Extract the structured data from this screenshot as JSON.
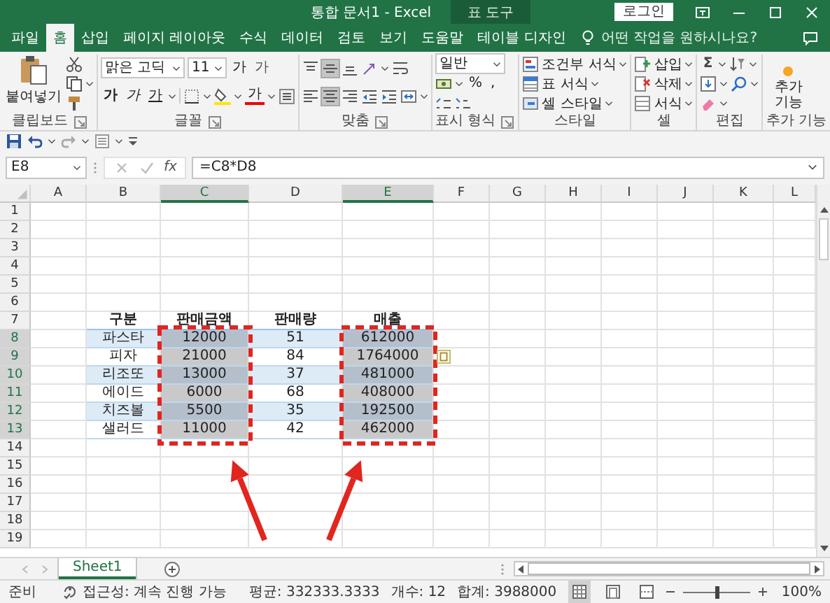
{
  "window": {
    "title": "통합 문서1 - Excel",
    "context_tab": "표 도구",
    "login": "로그인"
  },
  "tabs": [
    {
      "label": "파일",
      "selected": false
    },
    {
      "label": "홈",
      "selected": true
    },
    {
      "label": "삽입",
      "selected": false
    },
    {
      "label": "페이지 레이아웃",
      "selected": false
    },
    {
      "label": "수식",
      "selected": false
    },
    {
      "label": "데이터",
      "selected": false
    },
    {
      "label": "검토",
      "selected": false
    },
    {
      "label": "보기",
      "selected": false
    },
    {
      "label": "도움말",
      "selected": false
    },
    {
      "label": "테이블 디자인",
      "selected": false
    }
  ],
  "tell_me": {
    "placeholder": "어떤 작업을 원하시나요?"
  },
  "ribbon": [
    {
      "kind": "clipboard",
      "label": "클립보드",
      "launcher": true,
      "paste": "붙여넣기"
    },
    {
      "kind": "font",
      "label": "글꼴",
      "launcher": true,
      "font": "맑은 고딕",
      "size": "11",
      "grow": "가",
      "shrink": "가",
      "bold": "가",
      "italic": "가",
      "underline": "가",
      "color_button": "가"
    },
    {
      "kind": "alignment",
      "label": "맞춤",
      "launcher": true,
      "vertical_align": [
        {
          "kind": "top",
          "selected": false
        },
        {
          "kind": "middle",
          "selected": true
        },
        {
          "kind": "bottom",
          "selected": false
        }
      ],
      "horizontal_align": [
        {
          "kind": "left",
          "selected": false
        },
        {
          "kind": "center",
          "selected": true
        },
        {
          "kind": "right",
          "selected": false
        }
      ]
    },
    {
      "kind": "number",
      "label": "표시 형식",
      "launcher": true,
      "format": "일반",
      "percent": "%",
      "comma": ","
    },
    {
      "kind": "list",
      "label": "스타일",
      "launcher": false,
      "items": [
        "조건부 서식",
        "표 서식",
        "셀 스타일"
      ]
    },
    {
      "kind": "list",
      "label": "셀",
      "launcher": false,
      "items": [
        "삽입",
        "삭제",
        "서식"
      ]
    },
    {
      "kind": "editing",
      "label": "편집",
      "launcher": false,
      "sum": "Σ"
    },
    {
      "kind": "addin",
      "label": "추가 기능",
      "launcher": false,
      "button": "추가 기능"
    }
  ],
  "formula_bar": {
    "name_box": "E8",
    "fx": "fx",
    "formula": "=C8*D8"
  },
  "sheet": {
    "columns": [
      {
        "label": "A",
        "selected": false
      },
      {
        "label": "B",
        "selected": false
      },
      {
        "label": "C",
        "selected": true
      },
      {
        "label": "D",
        "selected": false
      },
      {
        "label": "E",
        "selected": true
      },
      {
        "label": "F",
        "selected": false
      },
      {
        "label": "G",
        "selected": false
      },
      {
        "label": "H",
        "selected": false
      },
      {
        "label": "I",
        "selected": false
      },
      {
        "label": "J",
        "selected": false
      },
      {
        "label": "K",
        "selected": false
      },
      {
        "label": "L",
        "selected": false
      }
    ],
    "rows": [
      {
        "label": "1",
        "selected": false
      },
      {
        "label": "2",
        "selected": false
      },
      {
        "label": "3",
        "selected": false
      },
      {
        "label": "4",
        "selected": false
      },
      {
        "label": "5",
        "selected": false
      },
      {
        "label": "6",
        "selected": false
      },
      {
        "label": "7",
        "selected": false
      },
      {
        "label": "8",
        "selected": true
      },
      {
        "label": "9",
        "selected": true
      },
      {
        "label": "10",
        "selected": true
      },
      {
        "label": "11",
        "selected": true
      },
      {
        "label": "12",
        "selected": true
      },
      {
        "label": "13",
        "selected": true
      },
      {
        "label": "14",
        "selected": false
      },
      {
        "label": "15",
        "selected": false
      },
      {
        "label": "16",
        "selected": false
      },
      {
        "label": "17",
        "selected": false
      },
      {
        "label": "18",
        "selected": false
      },
      {
        "label": "19",
        "selected": false
      }
    ]
  },
  "table": {
    "columns": [
      {
        "label": "구분",
        "selected": false,
        "marked": false
      },
      {
        "label": "판매금액",
        "selected": true,
        "marked": true
      },
      {
        "label": "판매량",
        "selected": false,
        "marked": false
      },
      {
        "label": "매출",
        "selected": true,
        "marked": true
      }
    ],
    "rows": [
      [
        "파스타",
        "12000",
        "51",
        "612000"
      ],
      [
        "피자",
        "21000",
        "84",
        "1764000"
      ],
      [
        "리조또",
        "13000",
        "37",
        "481000"
      ],
      [
        "에이드",
        "6000",
        "68",
        "408000"
      ],
      [
        "치즈볼",
        "5500",
        "35",
        "192500"
      ],
      [
        "샐러드",
        "11000",
        "42",
        "462000"
      ]
    ]
  },
  "sheet_tabs": [
    {
      "label": "Sheet1",
      "selected": true
    }
  ],
  "status_bar": {
    "mode": "준비",
    "accessibility": "접근성: 계속 진행 가능",
    "average": "평균: 332333.3333",
    "count": "개수: 12",
    "sum": "합계: 3988000",
    "views": [
      {
        "kind": "normal",
        "selected": true
      },
      {
        "kind": "page_layout",
        "selected": false
      },
      {
        "kind": "page_break",
        "selected": false
      }
    ],
    "zoom": {
      "level": 0.5,
      "reading": "100%"
    }
  }
}
